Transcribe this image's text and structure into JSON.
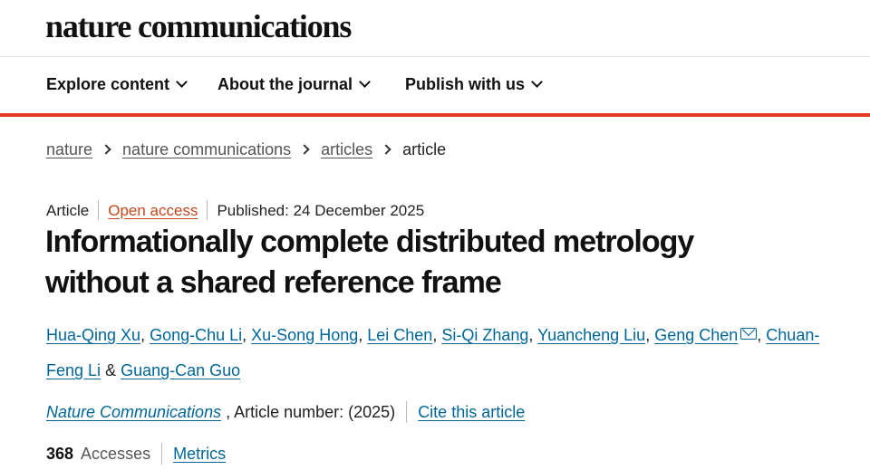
{
  "site": {
    "logo": "nature communications"
  },
  "nav": {
    "items": [
      {
        "label": "Explore content"
      },
      {
        "label": "About the journal"
      },
      {
        "label": "Publish with us"
      }
    ]
  },
  "breadcrumb": [
    "nature",
    "nature communications",
    "articles",
    "article"
  ],
  "article": {
    "type": "Article",
    "access": "Open access",
    "published": "Published: 24 December 2025",
    "title_line1": "Informationally complete distributed metrology",
    "title_line2": "without a shared reference frame",
    "authors": [
      "Hua-Qing Xu",
      "Gong-Chu Li",
      "Xu-Song Hong",
      "Lei Chen",
      "Si-Qi Zhang",
      "Yuancheng Liu",
      "Geng Chen",
      "Chuan-Feng Li",
      "Guang-Can Guo"
    ],
    "author_join": "&",
    "journal": "Nature Communications",
    "article_number": ", Article number:  (2025)",
    "cite_label": "Cite this article",
    "accesses_count": "368",
    "accesses_label": "Accesses",
    "metrics_label": "Metrics"
  },
  "icons": {
    "nav_dropdown": "chevron-down-icon",
    "breadcrumb_sep": "chevron-right-icon",
    "corresponding": "mail-icon"
  },
  "colors": {
    "accent_rule": "#e3371e",
    "link": "#006699",
    "open_access": "#c4471b"
  }
}
